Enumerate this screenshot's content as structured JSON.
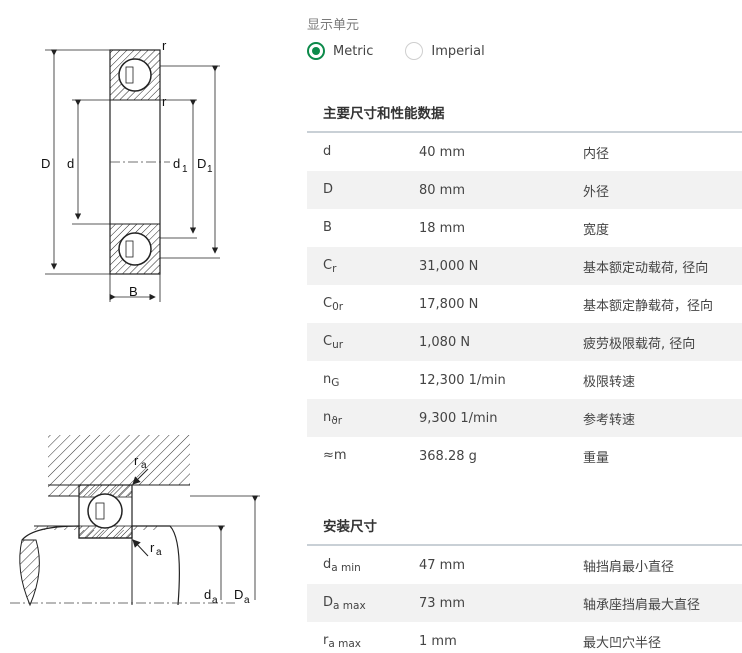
{
  "units": {
    "label": "显示单元",
    "options": [
      {
        "label": "Metric",
        "selected": true
      },
      {
        "label": "Imperial",
        "selected": false
      }
    ]
  },
  "drawing_labels": {
    "top": {
      "D": "D",
      "d": "d",
      "d1": "d",
      "d1_sub": "1",
      "D1": "D",
      "D1_sub": "1",
      "B": "B",
      "r_top": "r",
      "r_mid": "r"
    },
    "bottom": {
      "ra_top": "r",
      "ra_top_sub": "a",
      "ra_bottom": "r",
      "ra_bottom_sub": "a",
      "da": "d",
      "da_sub": "a",
      "Da": "D",
      "Da_sub": "a"
    }
  },
  "dimensions": {
    "title": "主要尺寸和性能数据",
    "rows": [
      {
        "sym": "d",
        "sub": "",
        "value": "40 mm",
        "desc": "内径"
      },
      {
        "sym": "D",
        "sub": "",
        "value": "80 mm",
        "desc": "外径"
      },
      {
        "sym": "B",
        "sub": "",
        "value": "18 mm",
        "desc": "宽度"
      },
      {
        "sym": "C",
        "sub": "r",
        "value": "31,000 N",
        "desc": "基本额定动载荷, 径向"
      },
      {
        "sym": "C",
        "sub": "0r",
        "value": "17,800 N",
        "desc": "基本额定静载荷，径向"
      },
      {
        "sym": "C",
        "sub": "ur",
        "value": "1,080 N",
        "desc": "疲劳极限载荷, 径向"
      },
      {
        "sym": "n",
        "sub": "G",
        "value": "12,300 1/min",
        "desc": "极限转速"
      },
      {
        "sym": "n",
        "sub": "ϑr",
        "value": "9,300 1/min",
        "desc": "参考转速"
      },
      {
        "sym": "≈m",
        "sub": "",
        "value": "368.28 g",
        "desc": "重量"
      }
    ]
  },
  "mounting": {
    "title": "安装尺寸",
    "rows": [
      {
        "sym": "d",
        "sub": "a min",
        "value": "47 mm",
        "desc": "轴挡肩最小直径"
      },
      {
        "sym": "D",
        "sub": "a max",
        "value": "73 mm",
        "desc": "轴承座挡肩最大直径"
      },
      {
        "sym": "r",
        "sub": "a max",
        "value": "1 mm",
        "desc": "最大凹穴半径"
      }
    ]
  }
}
